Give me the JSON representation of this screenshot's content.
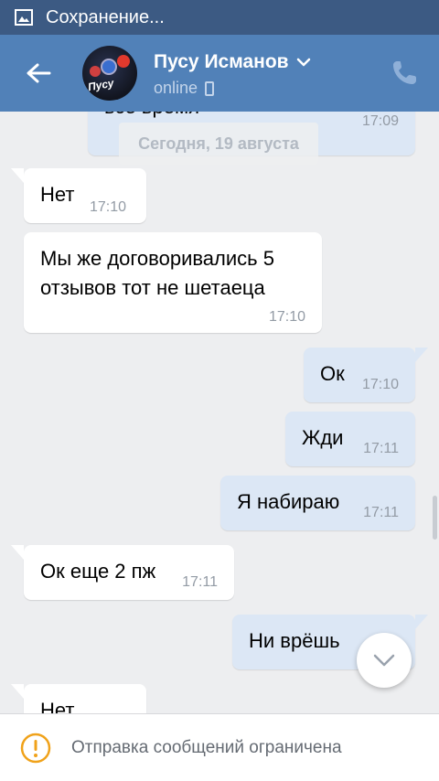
{
  "status_bar": {
    "text": "Сохранение...",
    "icon": "image-icon"
  },
  "header": {
    "name": "Пусу Исманов",
    "status": "online",
    "avatar_text": "Пусу",
    "icons": {
      "back": "arrow-left-icon",
      "dropdown": "chevron-down-icon",
      "call": "phone-icon",
      "device": "mobile-icon"
    },
    "bg_color": "#5181b8"
  },
  "chat": {
    "date_chip": "Сегодня, 19 августа",
    "messages": [
      {
        "dir": "out",
        "text": "всё время",
        "time": "17:09"
      },
      {
        "dir": "in",
        "text": "Нет",
        "time": "17:10"
      },
      {
        "dir": "in",
        "text_line1": "Мы же договоривались 5",
        "text_line2": "отзывов тот не шетаеца",
        "time": "17:10"
      },
      {
        "dir": "out",
        "text": "Ок",
        "time": "17:10"
      },
      {
        "dir": "out",
        "text": "Жди",
        "time": "17:11"
      },
      {
        "dir": "out",
        "text": "Я набираю",
        "time": "17:11"
      },
      {
        "dir": "in",
        "text": "Ок еще 2 пж",
        "time": "17:11"
      },
      {
        "dir": "out",
        "text": "Ни врёшь",
        "time": ""
      },
      {
        "dir": "in",
        "text": "Нет",
        "time": ""
      }
    ],
    "colors": {
      "incoming": "#ffffff",
      "outgoing": "#dce7f5",
      "background": "#edeef0"
    }
  },
  "banner": {
    "text": "Отправка сообщений ограничена",
    "icon": "warning-icon",
    "icon_color": "#f0a21a"
  }
}
